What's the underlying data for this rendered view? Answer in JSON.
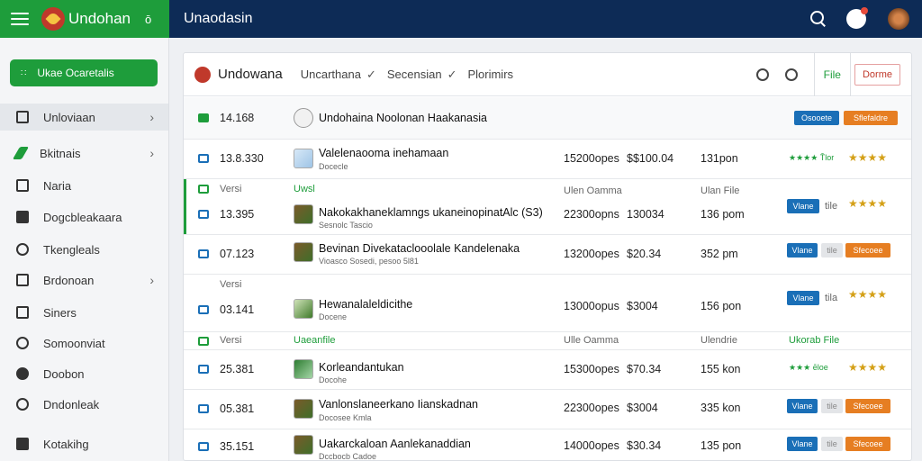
{
  "app": {
    "name": "Undohan",
    "user_icon_text": "ō",
    "window_title": "Unaodasin"
  },
  "sidebar": {
    "primary_button": "Ukae Ocaretalis",
    "items": [
      {
        "label": "Unloviaan"
      },
      {
        "label": "Bkitnais"
      },
      {
        "label": "Naria"
      },
      {
        "label": "Dogcbleakaara"
      },
      {
        "label": "Tkengleals"
      },
      {
        "label": "Brdonoan"
      },
      {
        "label": "Siners"
      },
      {
        "label": "Somoonviat"
      },
      {
        "label": "Doobon"
      },
      {
        "label": "Dndonleak"
      },
      {
        "label": "Kotakihg"
      }
    ]
  },
  "panel": {
    "title": "Undowana",
    "crumb1": "Uncarthana",
    "crumb2": "Secensian",
    "crumb3": "Plorimirs",
    "file_label": "File",
    "action_label": "Dorme"
  },
  "rows": [
    {
      "id": "14.168",
      "name": "Undohaina Noolonan Haakanasia"
    },
    {
      "id": "13.8.330",
      "name": "Valelenaooma inehamaan",
      "sub": "Docecle",
      "size": "15200opes",
      "price": "$$100.04",
      "time": "131pon"
    },
    {
      "id": "13.395",
      "name": "Nakokakhaneklamngs ukaneinopinatAlc (S3)",
      "sub": "Sesnolc Tascio",
      "size": "22300opns",
      "price": "130034",
      "time": "136 pom"
    },
    {
      "id": "07.123",
      "name": "Bevinan Divekataclooolale Kandelenaka",
      "sub": "Vioasco Sosedi, pesoo 5l81",
      "size": "13200opes",
      "price": "$20.34",
      "time": "352 pm"
    },
    {
      "id": "03.141",
      "name": "Hewanalaleldicithe",
      "sub": "Docene",
      "size": "13000opus",
      "price": "$3004",
      "time": "156 pon"
    },
    {
      "id": "25.381",
      "name": "Korleandantukan",
      "sub": "Docohe",
      "size": "15300opes",
      "price": "$70.34",
      "time": "155 kon"
    },
    {
      "id": "05.381",
      "name": "Vanlonslaneerkano Iianskadnan",
      "sub": "Docosee Kmla",
      "size": "22300opes",
      "price": "$3004",
      "time": "335 kon"
    },
    {
      "id": "35.151",
      "name": "Uakarckaloan Aanlekanaddian",
      "sub": "Dccbocb Cadoe",
      "size": "14000opes",
      "price": "$30.34",
      "time": "135 pon"
    }
  ],
  "groups": [
    {
      "label": "Versi",
      "col2": "Uwsl",
      "col3": "Ulen Oamma",
      "col4": "Ulan File"
    },
    {
      "label": "Versi"
    },
    {
      "label": "Versi",
      "col2": "Uaeanfile",
      "col3": "Ulle Oamma",
      "col4": "Ulendrie",
      "col5": "Ukorab File"
    }
  ],
  "buttons": {
    "blue_a": "Osooete",
    "orange_a": "Sflefaldre",
    "blue_b": "Vlane",
    "grey_b": "tile",
    "orange_b": "Sfecoee",
    "grey_c": "tila"
  },
  "ratings": {
    "stars": "★★★★",
    "green_a": "★★★★ Ťlor",
    "green_b": "★★★ ēloe"
  },
  "colors": {
    "green": "#1e9d3b",
    "navy": "#0d2b56",
    "blue": "#1a6fb7",
    "orange": "#e67e22"
  }
}
